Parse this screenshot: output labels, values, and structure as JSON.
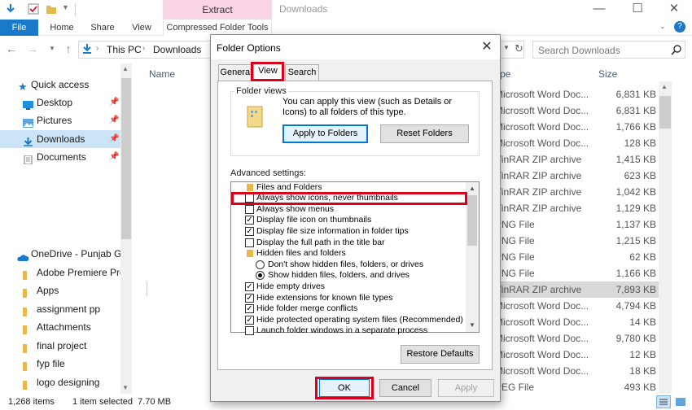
{
  "window": {
    "title": "Downloads",
    "context_tab": "Extract",
    "controls": [
      "—",
      "☐",
      "✕"
    ]
  },
  "ribbon": {
    "tabs": [
      "File",
      "Home",
      "Share",
      "View"
    ],
    "context_tab": "Compressed Folder Tools"
  },
  "address": {
    "path": [
      "This PC",
      "Downloads"
    ],
    "search_placeholder": "Search Downloads"
  },
  "nav": {
    "quick_access": "Quick access",
    "items": [
      {
        "label": "Desktop",
        "icon": "desktop-icon",
        "pinned": true
      },
      {
        "label": "Pictures",
        "icon": "pictures-icon",
        "pinned": true
      },
      {
        "label": "Downloads",
        "icon": "download-icon",
        "pinned": true
      },
      {
        "label": "Documents",
        "icon": "documents-icon",
        "pinned": true
      }
    ],
    "onedrive": "OneDrive - Punjab Gro",
    "folders": [
      "Adobe Premiere Pro",
      "Apps",
      "assignment pp",
      "Attachments",
      "final project",
      "fyp file",
      "logo designing"
    ]
  },
  "list": {
    "headers": {
      "name": "Name",
      "type": "ype",
      "size": "Size"
    },
    "rows": [
      {
        "type": "Microsoft Word Doc...",
        "size": "6,831 KB"
      },
      {
        "type": "Microsoft Word Doc...",
        "size": "6,831 KB"
      },
      {
        "type": "Microsoft Word Doc...",
        "size": "1,766 KB"
      },
      {
        "type": "Microsoft Word Doc...",
        "size": "128 KB"
      },
      {
        "type": "VinRAR ZIP archive",
        "size": "1,415 KB"
      },
      {
        "type": "VinRAR ZIP archive",
        "size": "623 KB"
      },
      {
        "type": "VinRAR ZIP archive",
        "size": "1,042 KB"
      },
      {
        "type": "VinRAR ZIP archive",
        "size": "1,129 KB"
      },
      {
        "type": "PNG File",
        "size": "1,137 KB"
      },
      {
        "type": "PNG File",
        "size": "1,215 KB"
      },
      {
        "type": "PNG File",
        "size": "62 KB"
      },
      {
        "type": "PNG File",
        "size": "1,166 KB"
      },
      {
        "type": "VinRAR ZIP archive",
        "size": "7,893 KB"
      },
      {
        "type": "Microsoft Word Doc...",
        "size": "4,794 KB"
      },
      {
        "type": "Microsoft Word Doc...",
        "size": "14 KB"
      },
      {
        "type": "Microsoft Word Doc...",
        "size": "9,780 KB"
      },
      {
        "type": "Microsoft Word Doc...",
        "size": "12 KB"
      },
      {
        "type": "Microsoft Word Doc...",
        "size": "18 KB"
      },
      {
        "type": "PEG File",
        "size": "493 KB"
      }
    ],
    "selected_index": 12
  },
  "status": {
    "count": "1,268 items",
    "selection": "1 item selected  7.70 MB"
  },
  "dialog": {
    "title": "Folder Options",
    "tabs": [
      "General",
      "View",
      "Search"
    ],
    "active_tab": "View",
    "folder_views": {
      "legend": "Folder views",
      "text": "You can apply this view (such as Details or Icons) to all folders of this type.",
      "apply_button": "Apply to Folders",
      "reset_button": "Reset Folders"
    },
    "advanced_label": "Advanced settings:",
    "advanced": [
      {
        "kind": "folder",
        "label": "Files and Folders"
      },
      {
        "kind": "check",
        "label": "Always show icons, never thumbnails",
        "checked": false
      },
      {
        "kind": "check",
        "label": "Always show menus",
        "checked": false
      },
      {
        "kind": "check",
        "label": "Display file icon on thumbnails",
        "checked": true
      },
      {
        "kind": "check",
        "label": "Display file size information in folder tips",
        "checked": true
      },
      {
        "kind": "check",
        "label": "Display the full path in the title bar",
        "checked": false
      },
      {
        "kind": "folder",
        "label": "Hidden files and folders"
      },
      {
        "kind": "radio",
        "label": "Don't show hidden files, folders, or drives",
        "checked": false
      },
      {
        "kind": "radio",
        "label": "Show hidden files, folders, and drives",
        "checked": true
      },
      {
        "kind": "check",
        "label": "Hide empty drives",
        "checked": true
      },
      {
        "kind": "check",
        "label": "Hide extensions for known file types",
        "checked": true
      },
      {
        "kind": "check",
        "label": "Hide folder merge conflicts",
        "checked": true
      },
      {
        "kind": "check",
        "label": "Hide protected operating system files (Recommended)",
        "checked": true
      },
      {
        "kind": "check",
        "label": "Launch folder windows in a separate process",
        "checked": false
      }
    ],
    "restore_button": "Restore Defaults",
    "ok": "OK",
    "cancel": "Cancel",
    "apply": "Apply"
  },
  "colors": {
    "accent": "#1979ca",
    "highlight": "#d9001b",
    "context_tab": "#f8d4e5",
    "selected_nav": "#cce4f7"
  }
}
